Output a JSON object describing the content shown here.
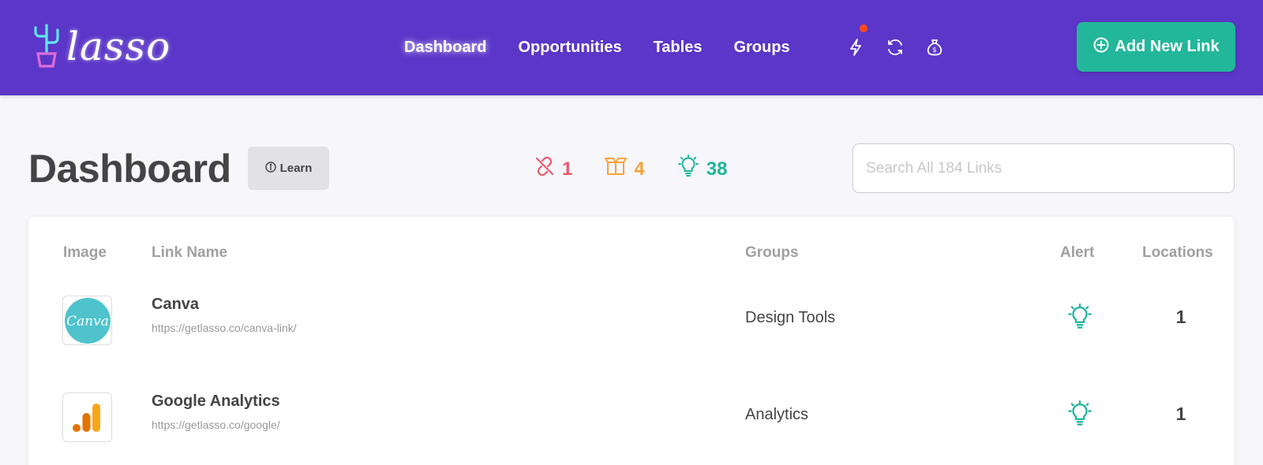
{
  "app": {
    "logo_text": "lasso"
  },
  "nav": {
    "items": [
      {
        "label": "Dashboard",
        "active": true
      },
      {
        "label": "Opportunities"
      },
      {
        "label": "Tables"
      },
      {
        "label": "Groups"
      }
    ]
  },
  "header_icons": [
    "lightning-icon",
    "refresh-icon",
    "money-bag-icon"
  ],
  "add_button": {
    "label": "Add New Link"
  },
  "page": {
    "title": "Dashboard",
    "learn_label": "Learn"
  },
  "stats": {
    "broken_links": "1",
    "out_of_stock": "4",
    "opportunities": "38"
  },
  "search": {
    "placeholder": "Search All 184 Links",
    "value": ""
  },
  "table": {
    "headers": {
      "image": "Image",
      "link_name": "Link Name",
      "groups": "Groups",
      "alert": "Alert",
      "locations": "Locations"
    },
    "rows": [
      {
        "name": "Canva",
        "url": "https://getlasso.co/canva-link/",
        "group": "Design Tools",
        "locations": "1",
        "logo_text": "Canva"
      },
      {
        "name": "Google Analytics",
        "url": "https://getlasso.co/google/",
        "group": "Analytics",
        "locations": "1"
      }
    ]
  },
  "colors": {
    "header_bg": "#5b36c8",
    "accent_teal": "#22b79a",
    "stat_red": "#e85a6c",
    "stat_orange": "#f5a33b",
    "notification": "#ff4a1c"
  }
}
